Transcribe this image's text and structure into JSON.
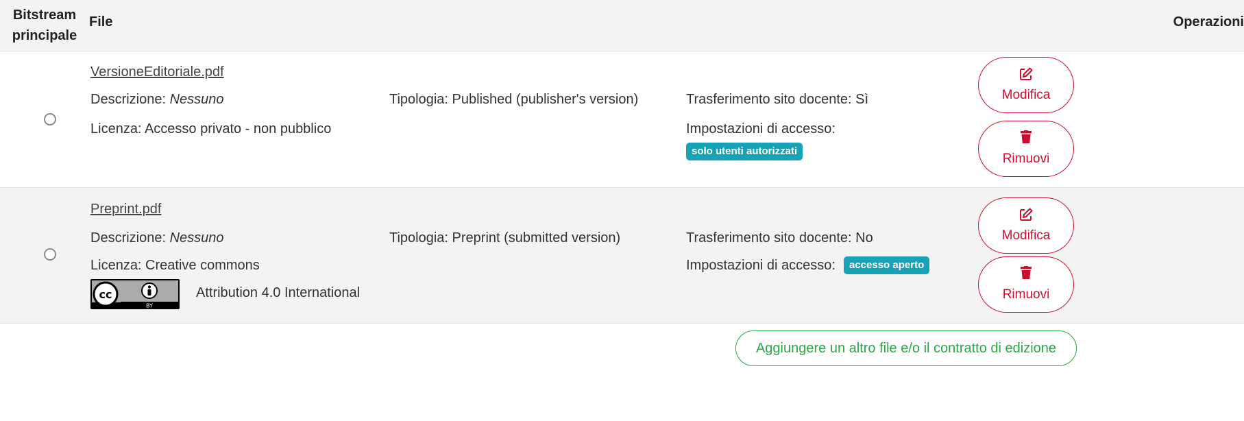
{
  "header": {
    "col_principale": "Bitstream\nprincipale",
    "col_file": "File",
    "col_operazioni": "Operazioni"
  },
  "rows": [
    {
      "filename": "VersioneEditoriale.pdf",
      "descrizione_label": "Descrizione:",
      "descrizione_value": "Nessuno",
      "tipologia": "Tipologia: Published (publisher's version)",
      "trasferimento": "Trasferimento sito docente: Sì",
      "licenza": "Licenza: Accesso privato - non pubblico",
      "accesso_label": "Impostazioni di accesso:",
      "accesso_badge": "solo utenti autorizzati",
      "edit_label": "Modifica",
      "remove_label": "Rimuovi"
    },
    {
      "filename": "Preprint.pdf",
      "descrizione_label": "Descrizione:",
      "descrizione_value": "Nessuno",
      "tipologia": "Tipologia: Preprint (submitted version)",
      "trasferimento": "Trasferimento sito docente: No",
      "licenza": "Licenza: Creative commons",
      "license_name": "Attribution 4.0 International",
      "cc_logo_text": "BY",
      "accesso_label": "Impostazioni di accesso:",
      "accesso_badge": "accesso aperto",
      "edit_label": "Modifica",
      "remove_label": "Rimuovi"
    }
  ],
  "add_button_label": "Aggiungere un altro file e/o il contratto di edizione",
  "colors": {
    "header_bg": "#f3f3f3",
    "danger": "#c8102e",
    "success": "#28a745",
    "badge_bg": "#17a2b8"
  },
  "icons": {
    "edit": "pencil-square-icon",
    "remove": "trash-icon",
    "license": "cc-by-icon"
  }
}
